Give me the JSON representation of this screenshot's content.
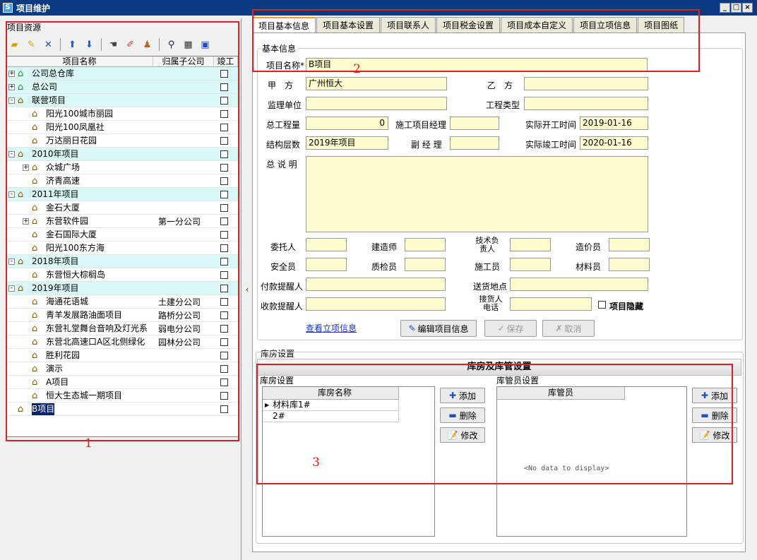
{
  "window": {
    "title": "项目维护",
    "min": "_",
    "max": "□",
    "close": "×"
  },
  "left": {
    "title": "项目资源",
    "columns": [
      "项目名称",
      "归属子公司",
      "竣工"
    ],
    "rows": [
      {
        "name": "公司总仓库",
        "level": 0,
        "group": true,
        "exp": "+",
        "green": true,
        "company": ""
      },
      {
        "name": "总公司",
        "level": 0,
        "group": true,
        "exp": "+",
        "green": true,
        "company": ""
      },
      {
        "name": "联营项目",
        "level": 0,
        "group": true,
        "exp": "-",
        "company": ""
      },
      {
        "name": "阳光100城市丽园",
        "level": 1,
        "company": ""
      },
      {
        "name": "阳光100凤凰社",
        "level": 1,
        "company": ""
      },
      {
        "name": "万达丽日花园",
        "level": 1,
        "company": ""
      },
      {
        "name": "2010年项目",
        "level": 0,
        "group": true,
        "exp": "-",
        "company": ""
      },
      {
        "name": "众城广场",
        "level": 1,
        "exp": "+",
        "company": ""
      },
      {
        "name": "济青高速",
        "level": 1,
        "company": ""
      },
      {
        "name": "2011年项目",
        "level": 0,
        "group": true,
        "exp": "-",
        "company": ""
      },
      {
        "name": "金石大厦",
        "level": 1,
        "company": ""
      },
      {
        "name": "东营软件园",
        "level": 1,
        "exp": "+",
        "company": "第一分公司"
      },
      {
        "name": "金石国际大厦",
        "level": 1,
        "company": ""
      },
      {
        "name": "阳光100东方海",
        "level": 1,
        "company": ""
      },
      {
        "name": "2018年项目",
        "level": 0,
        "group": true,
        "exp": "-",
        "company": ""
      },
      {
        "name": "东营恒大棕榈岛",
        "level": 1,
        "company": ""
      },
      {
        "name": "2019年项目",
        "level": 0,
        "group": true,
        "exp": "-",
        "company": ""
      },
      {
        "name": "海通花语城",
        "level": 1,
        "company": "土建分公司"
      },
      {
        "name": "青羊发展路油面项目",
        "level": 1,
        "company": "路桥分公司"
      },
      {
        "name": "东营礼堂舞台音响及灯光系",
        "level": 1,
        "company": "弱电分公司"
      },
      {
        "name": "东营北高速口A区北侧绿化",
        "level": 1,
        "company": "园林分公司"
      },
      {
        "name": "胜利花园",
        "level": 1,
        "company": ""
      },
      {
        "name": "演示",
        "level": 1,
        "company": ""
      },
      {
        "name": "A项目",
        "level": 1,
        "company": ""
      },
      {
        "name": "恒大生态城一期项目",
        "level": 1,
        "company": ""
      },
      {
        "name": "B项目",
        "level": 0,
        "selected": true,
        "company": ""
      }
    ]
  },
  "tabs": [
    "项目基本信息",
    "项目基本设置",
    "项目联系人",
    "项目税金设置",
    "项目成本自定义",
    "项目立项信息",
    "项目图纸"
  ],
  "basic": {
    "group_title": "基本信息",
    "name_label": "项目名称*",
    "name_value": "B项目",
    "jia_label": "甲　方",
    "jia_value": "广州恒大",
    "yi_label": "乙　方",
    "yi_value": "",
    "supervisor_label": "监理单位",
    "supervisor_value": "",
    "type_label": "工程类型",
    "type_value": "",
    "total_label": "总工程量",
    "total_value": "0",
    "pm_label": "施工项目经理",
    "pm_value": "",
    "start_label": "实际开工时间",
    "start_value": "2019-01-16",
    "level_label": "结构层数",
    "level_value": "2019年项目",
    "vice_label": "副 经 理",
    "vice_value": "",
    "end_label": "实际竣工时间",
    "end_value": "2020-01-16",
    "desc_label": "总 说 明",
    "desc_value": "",
    "client_label": "委托人",
    "architect_label": "建造师",
    "tech_label": "技术负责人",
    "cost_label": "造价员",
    "safety_label": "安全员",
    "quality_label": "质检员",
    "worker_label": "施工员",
    "material_label": "材料员",
    "payremind_label": "付款提醒人",
    "delivery_label": "送货地点",
    "recvremind_label": "收款提醒人",
    "receiver_label": "接货人电话",
    "hide_label": "项目隐藏",
    "view_link": "查看立项信息",
    "edit_btn": "编辑项目信息",
    "save_btn": "保存",
    "cancel_btn": "取消"
  },
  "warehouse": {
    "section_title": "库房设置",
    "header": "库房及库管设置",
    "left_title": "库房设置",
    "left_col": "库房名称",
    "left_rows": [
      "材料库1#",
      "2#"
    ],
    "right_title": "库管员设置",
    "right_col": "库管员",
    "no_data": "<No data to display>",
    "add": "添加",
    "del": "删除",
    "edit": "修改"
  },
  "annotations": [
    "1",
    "2",
    "3"
  ]
}
